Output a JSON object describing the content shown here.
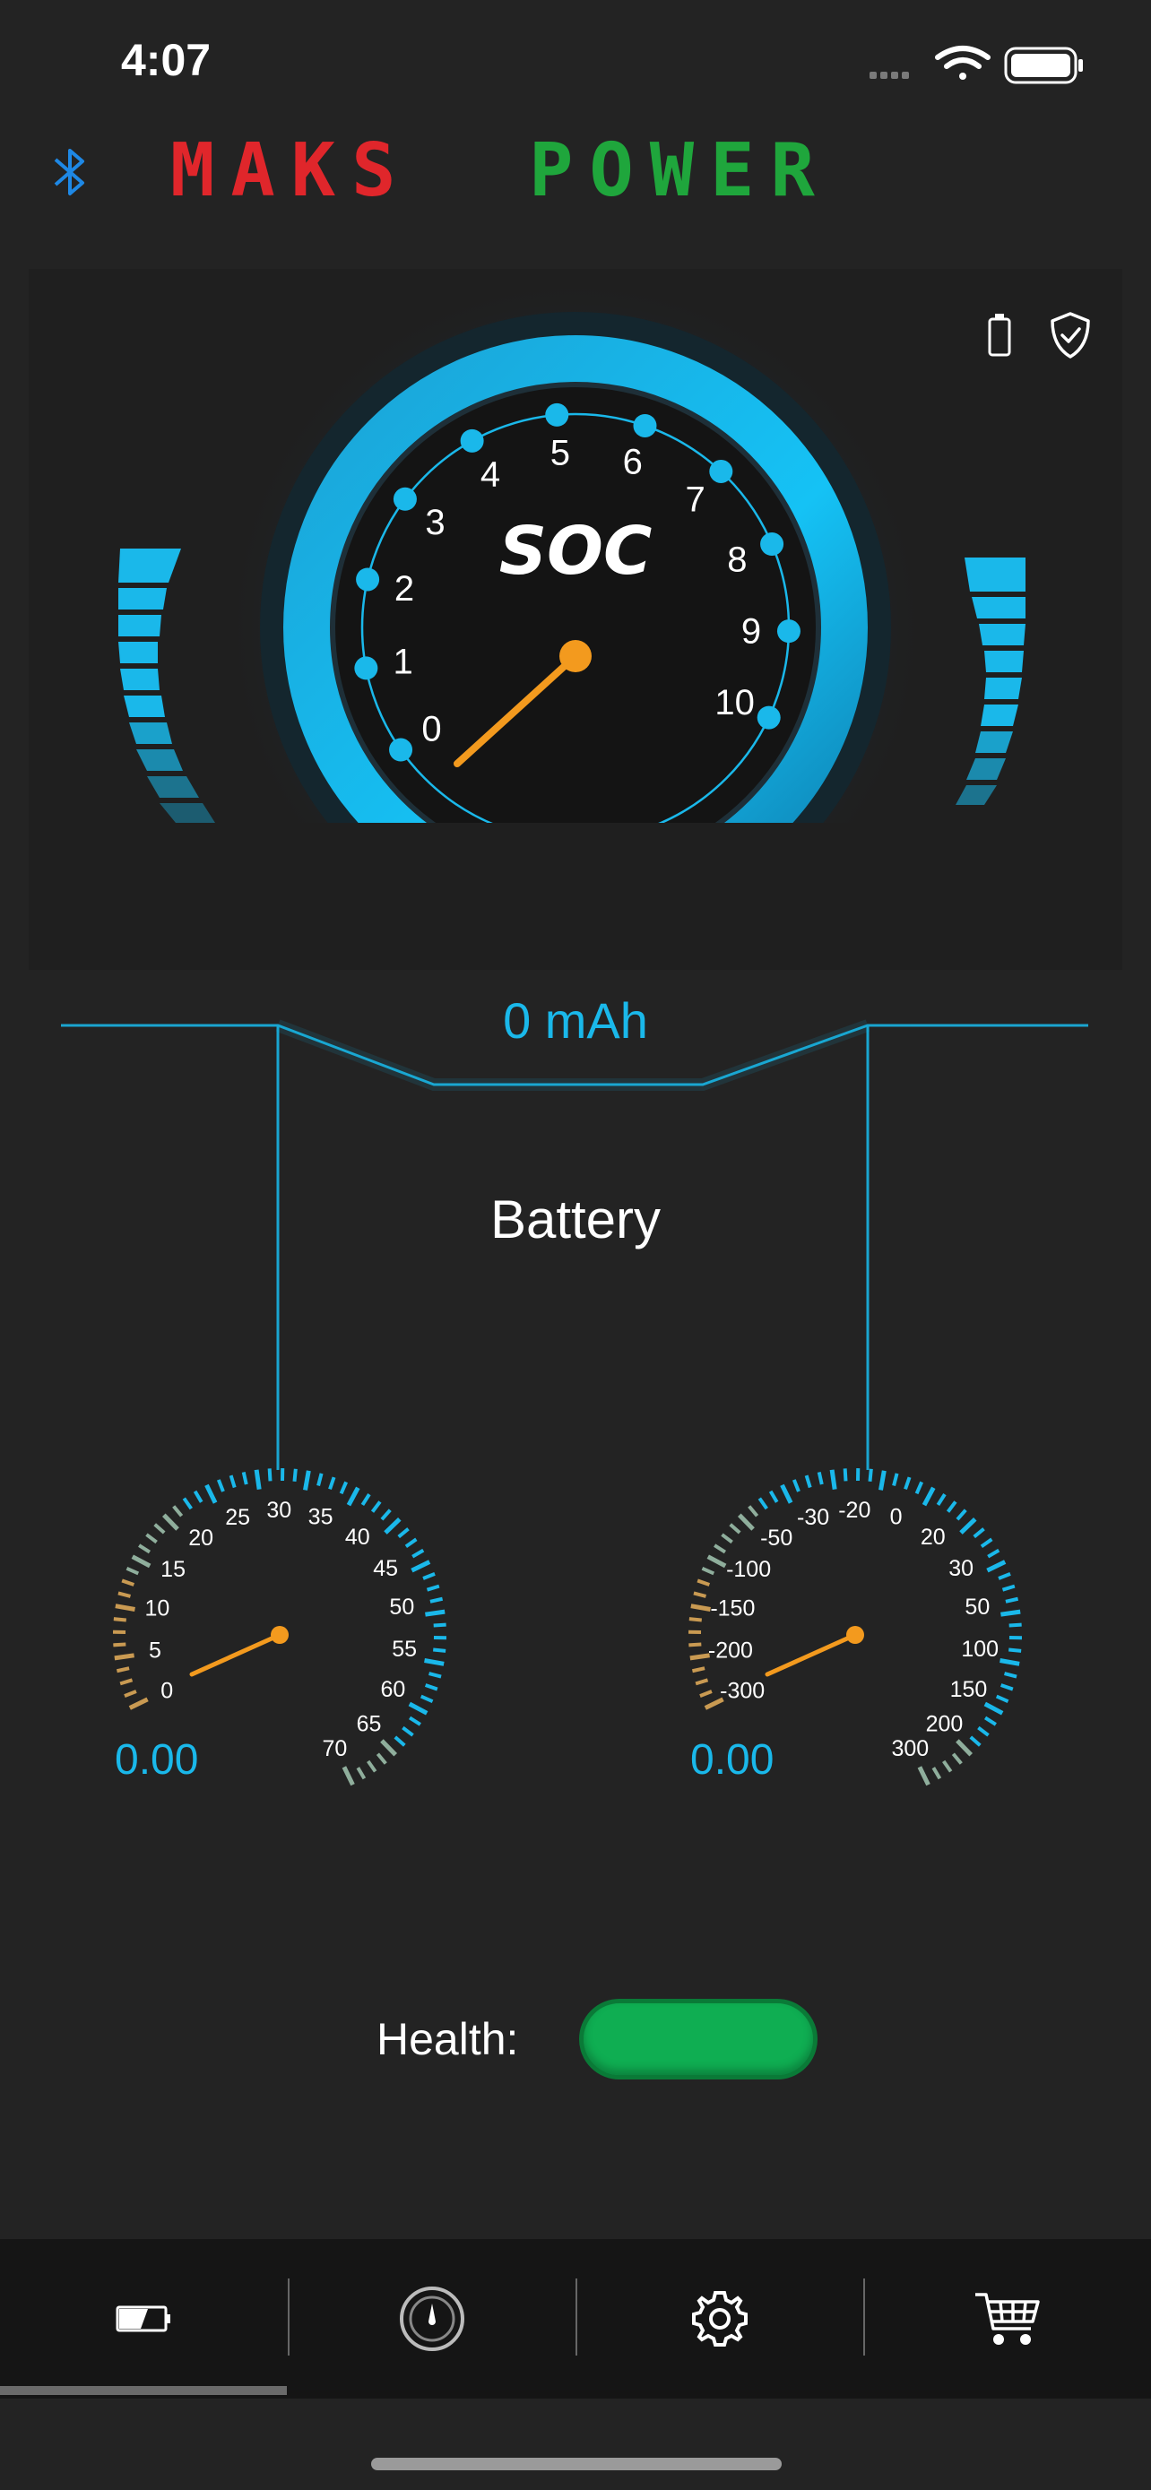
{
  "status_bar": {
    "time": "4:07"
  },
  "header": {
    "logo_part1": "MAKS",
    "logo_part2": "POWER",
    "colors": {
      "logo_red": "#e0262b",
      "logo_green": "#1fa63c",
      "bluetooth": "#1e88e5"
    }
  },
  "soc_gauge": {
    "label": "SOC",
    "ticks": [
      "0",
      "1",
      "2",
      "3",
      "4",
      "5",
      "6",
      "7",
      "8",
      "9",
      "10"
    ],
    "needle_value": 0
  },
  "capacity": {
    "text": "0 mAh"
  },
  "battery_label": "Battery",
  "left_gauge": {
    "ticks": [
      "0",
      "5",
      "10",
      "15",
      "20",
      "25",
      "30",
      "35",
      "40",
      "45",
      "50",
      "55",
      "60",
      "65",
      "70"
    ],
    "value": "0.00"
  },
  "right_gauge": {
    "ticks": [
      "-300",
      "-200",
      "-150",
      "-100",
      "-50",
      "-30",
      "-20",
      "0",
      "20",
      "30",
      "50",
      "100",
      "150",
      "200",
      "300"
    ],
    "value": "0.00"
  },
  "health": {
    "label": "Health:",
    "status_color": "#0fae52"
  },
  "tabs": [
    {
      "name": "battery",
      "icon": "battery-icon"
    },
    {
      "name": "gauge",
      "icon": "gauge-icon"
    },
    {
      "name": "settings",
      "icon": "gear-icon"
    },
    {
      "name": "shop",
      "icon": "cart-icon"
    }
  ],
  "colors": {
    "accent": "#1ab8ea",
    "needle": "#f39a1e",
    "background": "#232323"
  }
}
